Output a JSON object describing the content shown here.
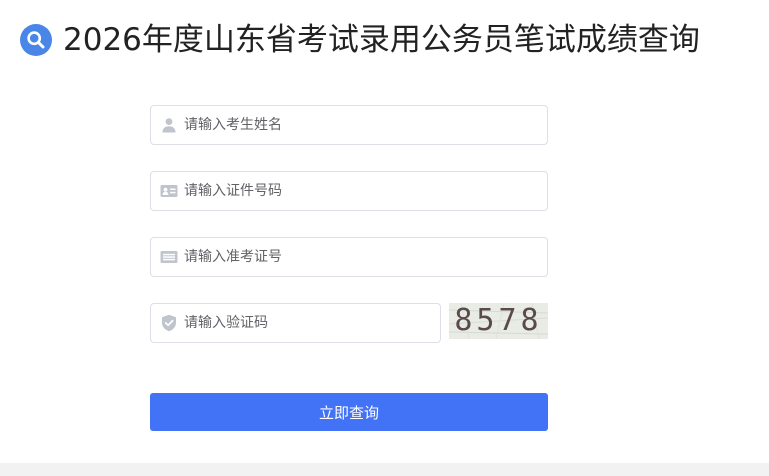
{
  "header": {
    "title": "2026年度山东省考试录用公务员笔试成绩查询",
    "icon": "search-icon",
    "accent_color": "#4a86e8"
  },
  "form": {
    "name_field": {
      "placeholder": "请输入考生姓名",
      "value": "",
      "icon": "user-icon"
    },
    "id_field": {
      "placeholder": "请输入证件号码",
      "value": "",
      "icon": "id-card-icon"
    },
    "ticket_field": {
      "placeholder": "请输入准考证号",
      "value": "",
      "icon": "ticket-icon"
    },
    "captcha_field": {
      "placeholder": "请输入验证码",
      "value": "",
      "icon": "shield-check-icon"
    },
    "captcha_image_text": "8578",
    "submit_label": "立即查询",
    "submit_color": "#4272f5"
  }
}
